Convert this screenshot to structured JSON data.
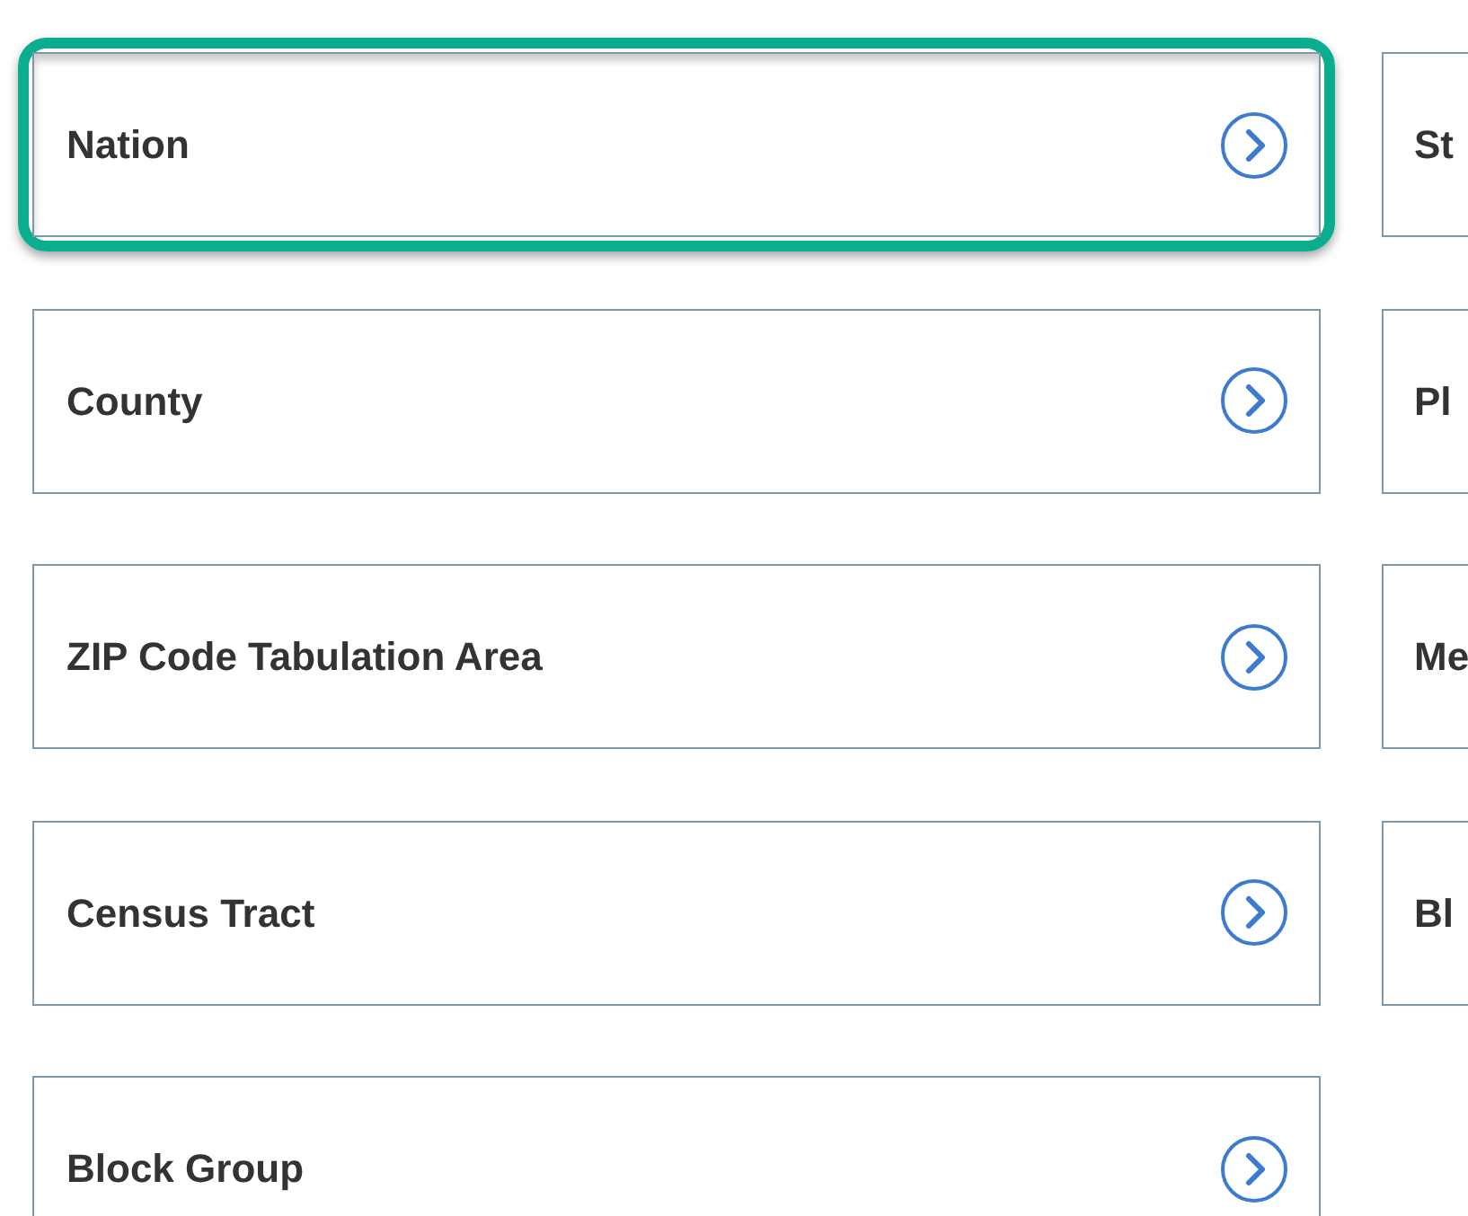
{
  "left_column": [
    {
      "label": "Nation",
      "selected": true
    },
    {
      "label": "County",
      "selected": false
    },
    {
      "label": "ZIP Code Tabulation Area",
      "selected": false
    },
    {
      "label": "Census Tract",
      "selected": false
    },
    {
      "label": "Block Group",
      "selected": false
    }
  ],
  "right_column": [
    {
      "label": "St",
      "selected": false
    },
    {
      "label": "Pl",
      "selected": false
    },
    {
      "label": "Me",
      "selected": false
    },
    {
      "label": "Bl",
      "selected": false
    }
  ]
}
